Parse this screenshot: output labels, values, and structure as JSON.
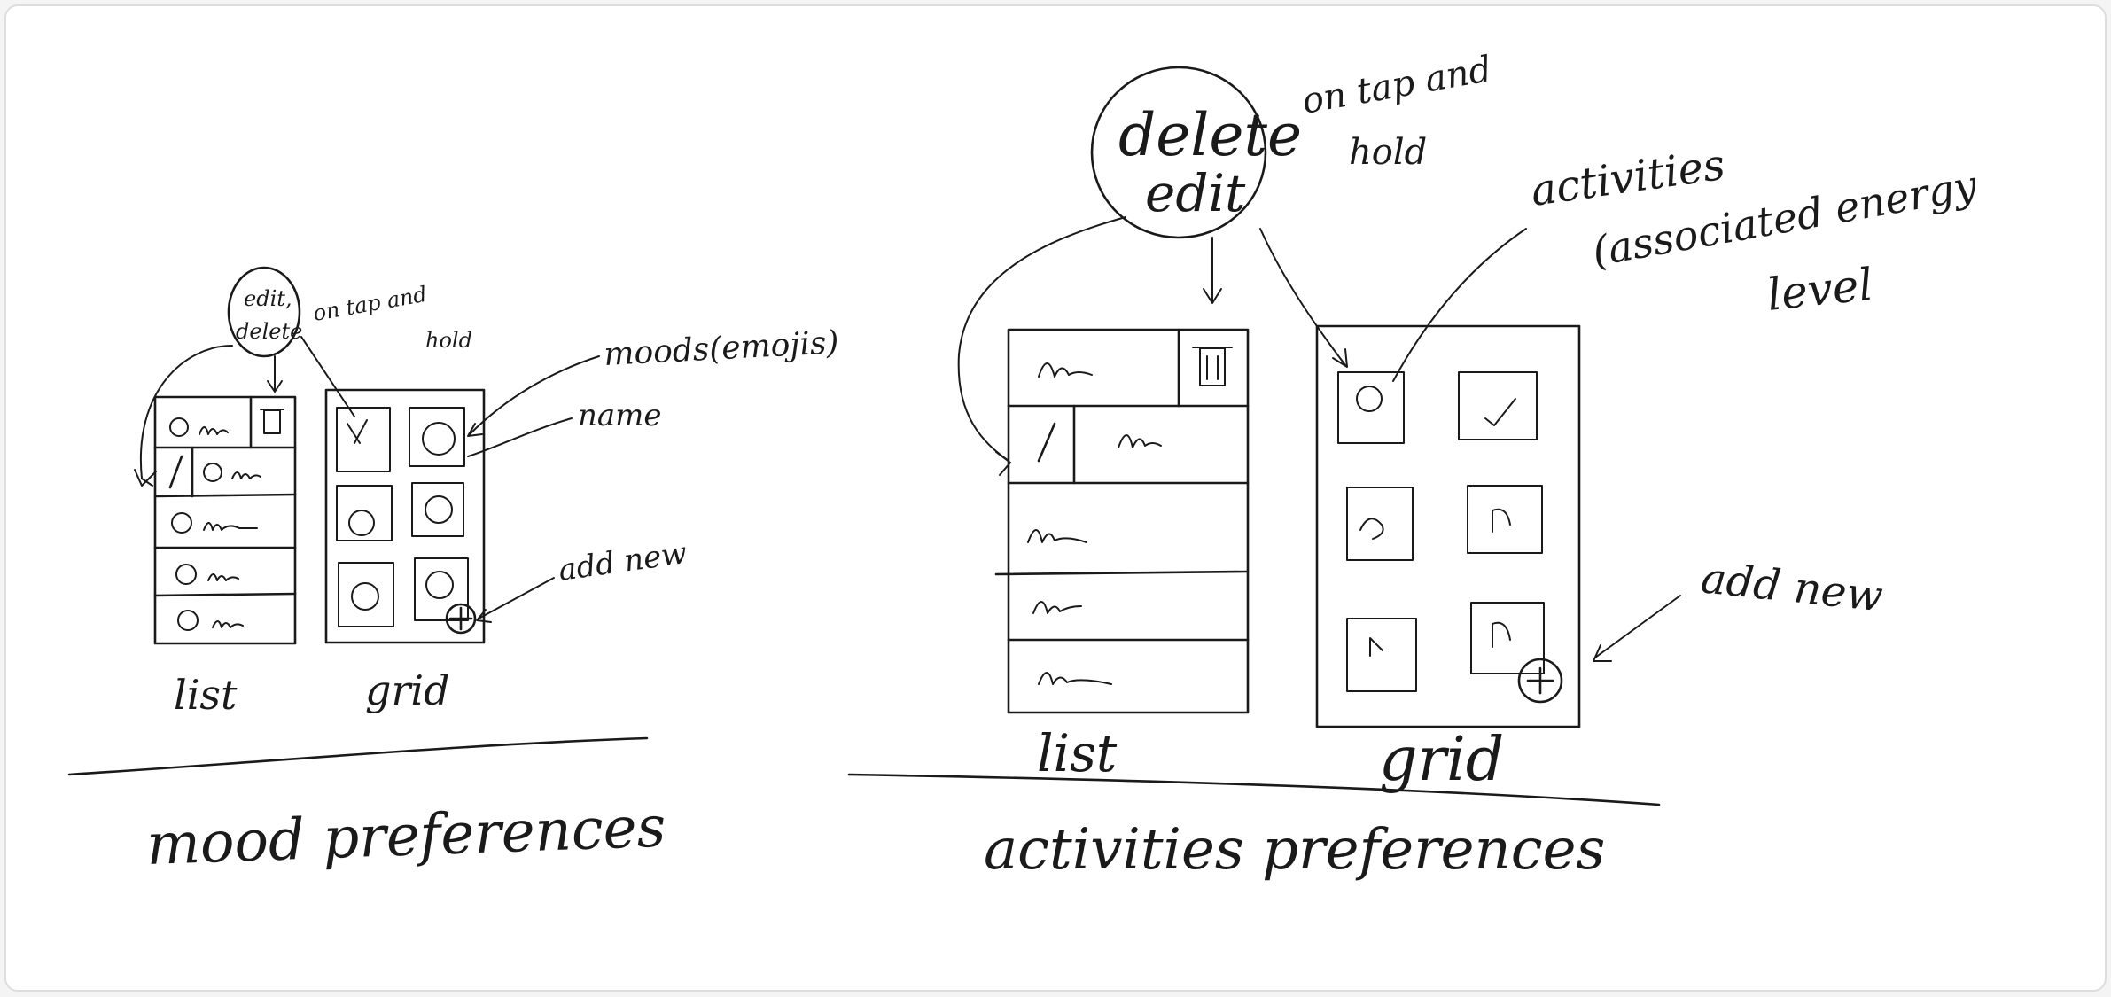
{
  "left": {
    "bubble": {
      "line1": "edit,",
      "line2": "delete",
      "side1": "on tap and",
      "side2": "hold"
    },
    "label_moods": "moods(emojis)",
    "label_name": "name",
    "label_add_new": "add new",
    "label_list": "list",
    "label_grid": "grid",
    "title": "mood preferences"
  },
  "right": {
    "bubble": {
      "line1": "delete",
      "line2": "edit",
      "side1": "on tap and",
      "side2": "hold"
    },
    "label_activities": "activities",
    "label_energy1": "(associated energy",
    "label_energy2": "level",
    "label_add_new": "add new",
    "label_list": "list",
    "label_grid": "grid",
    "title": "activities preferences"
  },
  "colors": {
    "ink": "#1a1a1a",
    "paper": "#ffffff",
    "background": "#f4f4f4"
  }
}
